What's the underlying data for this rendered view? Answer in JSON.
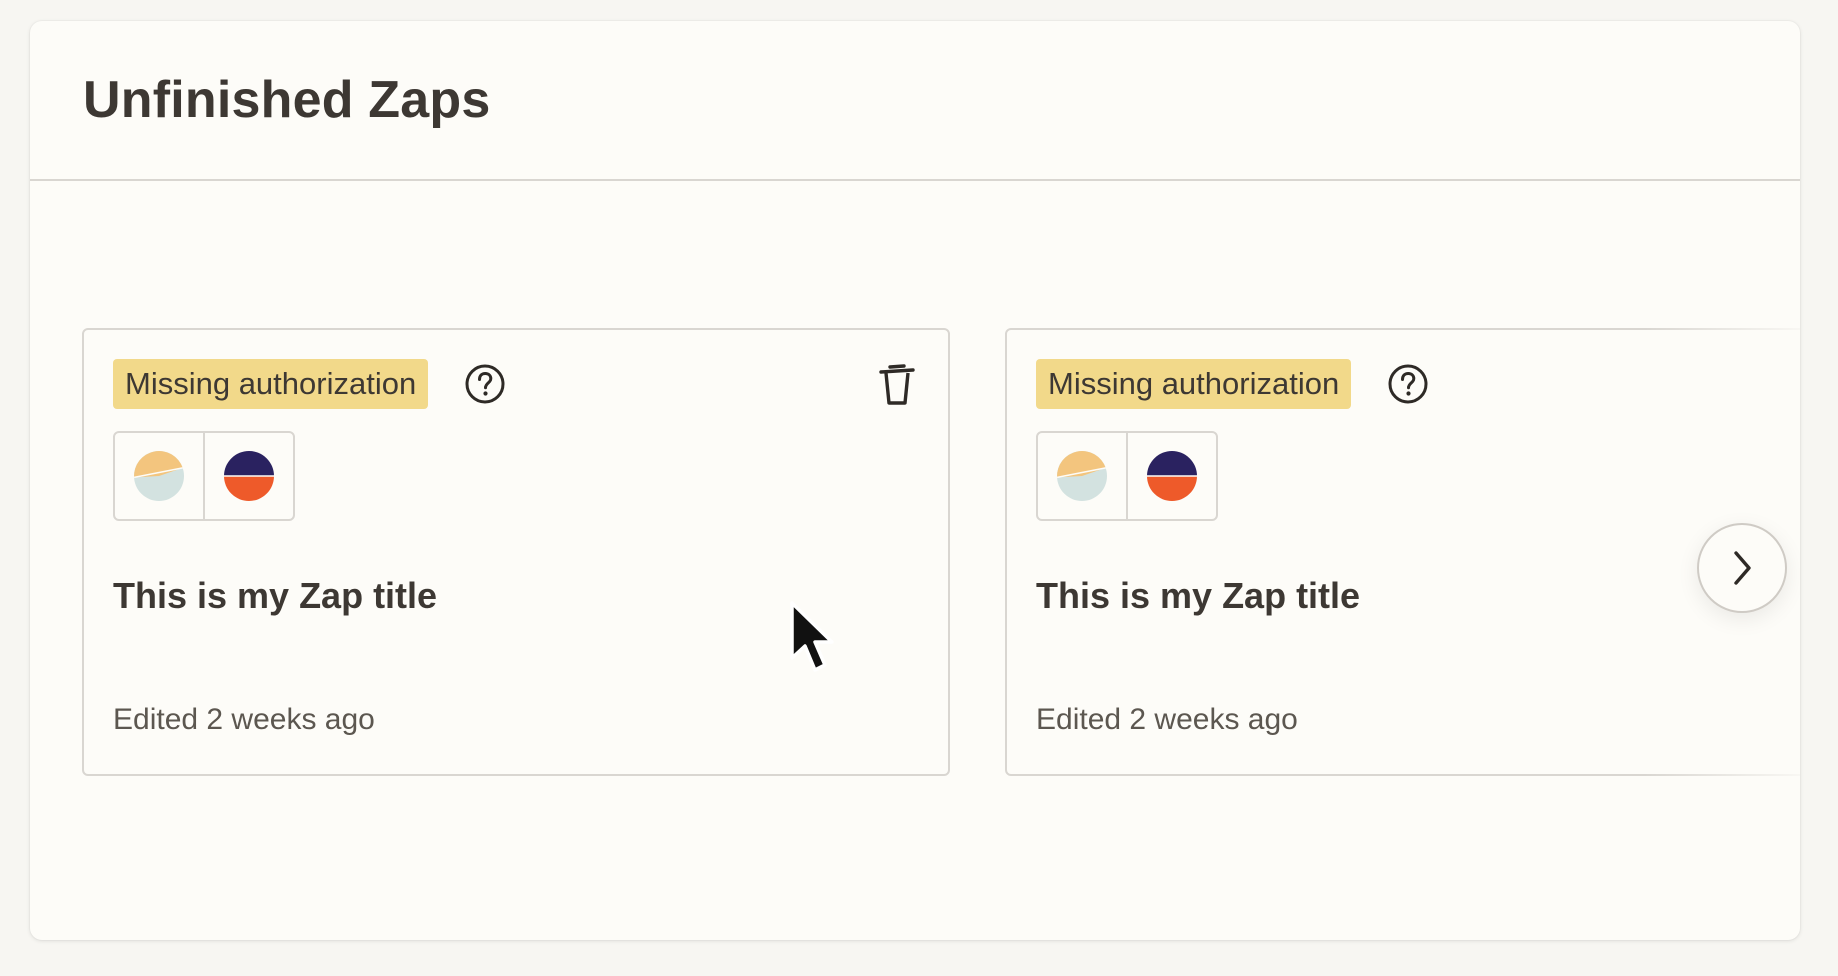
{
  "panel": {
    "title": "Unfinished Zaps"
  },
  "cards": [
    {
      "status_badge": "Missing authorization",
      "help_icon": "question-circle-icon",
      "delete_icon": "trash-icon",
      "apps": [
        "pie-app-icon",
        "circle-app-icon"
      ],
      "title": "This is my Zap title",
      "edited": "Edited 2 weeks ago"
    },
    {
      "status_badge": "Missing authorization",
      "help_icon": "question-circle-icon",
      "apps": [
        "pie-app-icon",
        "circle-app-icon"
      ],
      "title": "This is my Zap title",
      "edited": "Edited 2 weeks ago"
    }
  ],
  "carousel": {
    "next_icon": "chevron-right-icon"
  },
  "colors": {
    "badge": "#f2d98a",
    "text": "#3d3833",
    "border": "#d9d6d1",
    "app_pie_a": "#f3c57e",
    "app_pie_b": "#d3e2e0",
    "app_circle_top": "#2a2260",
    "app_circle_bottom": "#ee5a2a"
  }
}
